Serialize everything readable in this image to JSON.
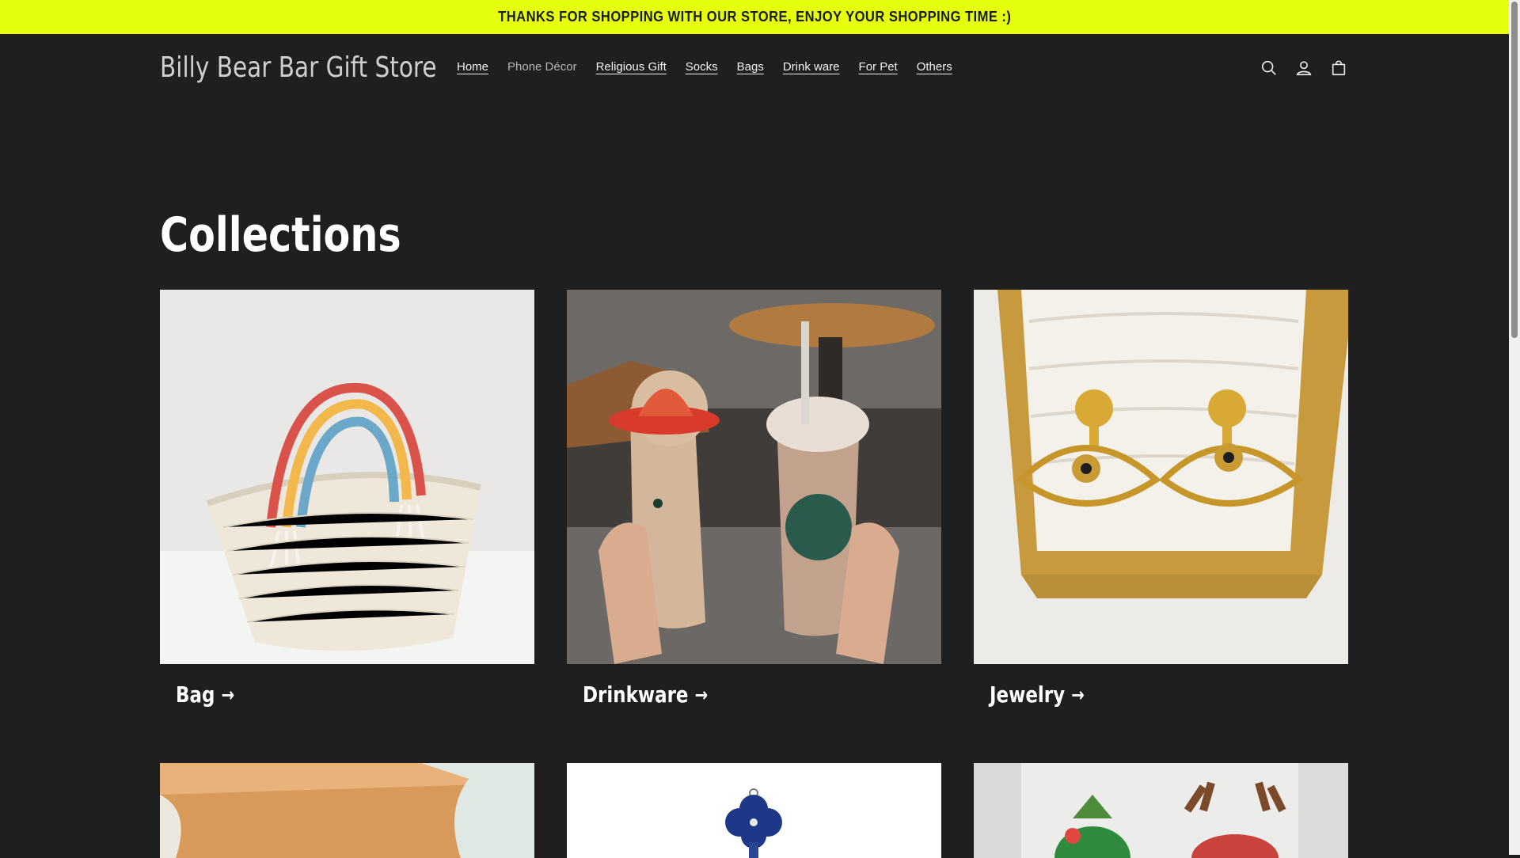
{
  "announcement": "THANKS FOR SHOPPING WITH OUR STORE, ENJOY YOUR SHOPPING TIME :)",
  "store_name": "Billy Bear Bar Gift Store",
  "nav": [
    {
      "label": "Home"
    },
    {
      "label": "Phone Décor"
    },
    {
      "label": "Religious Gift"
    },
    {
      "label": "Socks"
    },
    {
      "label": "Bags"
    },
    {
      "label": "Drink ware"
    },
    {
      "label": "For Pet"
    },
    {
      "label": "Others"
    }
  ],
  "header_icons": [
    "search-icon",
    "account-icon",
    "cart-icon"
  ],
  "page_title": "Collections",
  "collections": [
    {
      "label": "Bag",
      "image": "rainbow-cotton-rope-bag"
    },
    {
      "label": "Drinkware",
      "image": "bear-cup-and-frappuccino"
    },
    {
      "label": "Jewelry",
      "image": "gold-evil-eye-earrings"
    },
    {
      "label": "",
      "image": "wooden-surface-item"
    },
    {
      "label": "",
      "image": "blue-cross-pendant"
    },
    {
      "label": "",
      "image": "christmas-plush-toys"
    }
  ],
  "colors": {
    "announcement_bg": "#e6ff0c",
    "page_bg": "#1f1f20",
    "text": "#ffffff"
  }
}
